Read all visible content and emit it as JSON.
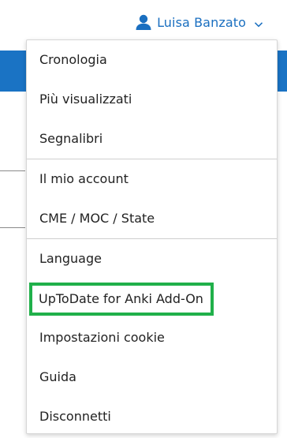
{
  "header": {
    "user_name": "Luisa Banzato",
    "user_icon": "user-icon",
    "chevron_icon": "chevron-down-icon",
    "accent_color": "#1a6fc0"
  },
  "menu": {
    "groups": [
      {
        "items": [
          {
            "label": "Cronologia"
          },
          {
            "label": "Più visualizzati"
          },
          {
            "label": "Segnalibri"
          }
        ]
      },
      {
        "items": [
          {
            "label": "Il mio account"
          },
          {
            "label": "CME / MOC / State"
          }
        ]
      },
      {
        "items": [
          {
            "label": "Language"
          },
          {
            "label": "UpToDate for Anki Add-On",
            "highlighted": true
          },
          {
            "label": "Impostazioni cookie"
          },
          {
            "label": "Guida"
          },
          {
            "label": "Disconnetti"
          }
        ]
      }
    ],
    "highlight_color": "#20b04a"
  }
}
